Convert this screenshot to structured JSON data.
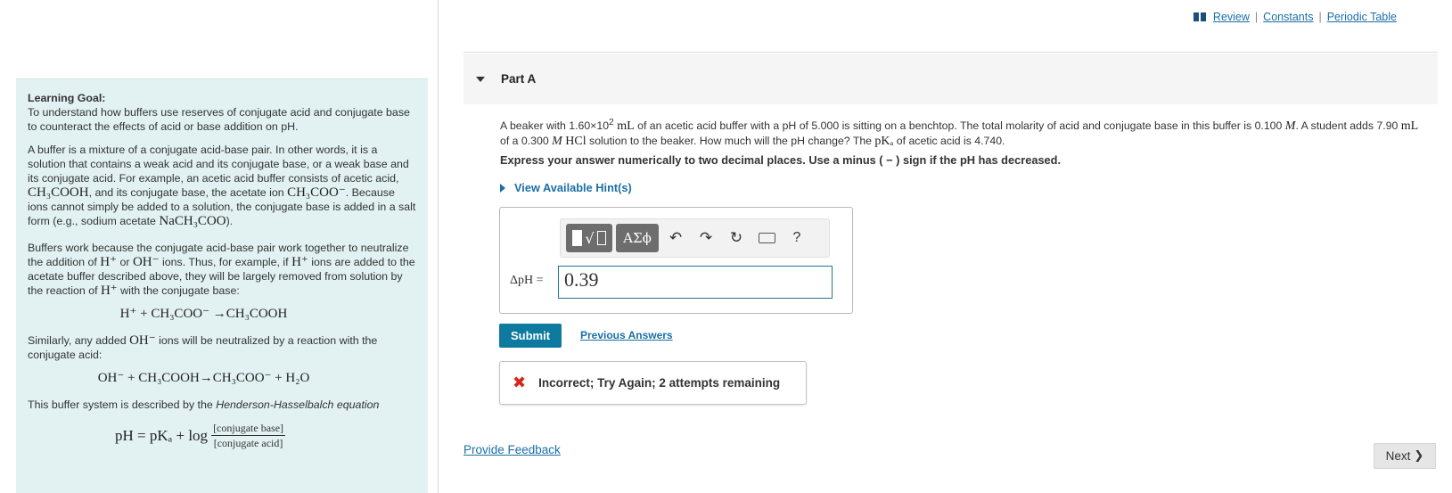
{
  "learning_goal": {
    "title": "Learning Goal:",
    "intro": "To understand how buffers use reserves of conjugate acid and conjugate base to counteract the effects of acid or base addition on pH.",
    "p1_a": "A buffer is a mixture of a conjugate acid-base pair. In other words, it is a solution that contains a weak acid and its conjugate base, or a weak base and its conjugate acid. For example, an acetic acid buffer consists of acetic acid, ",
    "p1_acid": "CH₃COOH",
    "p1_b": ", and its conjugate base, the acetate ion ",
    "p1_ion": "CH₃COO⁻",
    "p1_c": ". Because ions cannot simply be added to a solution, the conjugate base is added in a salt form (e.g., sodium acetate ",
    "p1_salt": "NaCH₃COO",
    "p1_d": ").",
    "p2_a": "Buffers work because the conjugate acid-base pair work together to neutralize the addition of ",
    "p2_h": "H⁺",
    "p2_or": " or ",
    "p2_oh": "OH⁻",
    "p2_b": " ions. Thus, for example, if ",
    "p2_h2": "H⁺",
    "p2_c": " ions are added to the acetate buffer described above, they will be largely removed from solution by the reaction of ",
    "p2_h3": "H⁺",
    "p2_d": " with the conjugate base:",
    "eq1": "H⁺ + CH₃COO⁻ →CH₃COOH",
    "p3_a": "Similarly, any added ",
    "p3_oh": "OH⁻",
    "p3_b": " ions will be neutralized by a reaction with the conjugate acid:",
    "eq2": "OH⁻ + CH₃COOH→CH₃COO⁻ + H₂O",
    "p4_a": "This buffer system is described by the ",
    "p4_em": "Henderson-Hasselbalch equation",
    "hh_lhs": "pH = pKₐ + log",
    "hh_num": "[conjugate base]",
    "hh_den": "[conjugate acid]"
  },
  "top_links": {
    "review": "Review",
    "constants": "Constants",
    "periodic": "Periodic Table",
    "sep": "|"
  },
  "part": {
    "title": "Part A"
  },
  "question": {
    "t1": "A beaker with 1.60×10",
    "t1_sup": "2",
    "t1_unit": " mL",
    "t2": " of an acetic acid buffer with a pH of 5.000 is sitting on a benchtop. The total molarity of acid and conjugate base in this buffer is 0.100 ",
    "t2_m": "M",
    "t3": ". A student adds 7.90 ",
    "t3_unit": "mL",
    "t4": " of a 0.300 ",
    "t4_m": "M",
    "t4_hcl": " HCl",
    "t5": " solution to the beaker. How much will the pH change? The ",
    "t5_pka": "pKₐ",
    "t6": " of acetic acid is 4.740."
  },
  "instruction": "Express your answer numerically to two decimal places. Use a minus ( − ) sign if the pH has decreased.",
  "hints_label": "View Available Hint(s)",
  "toolbar": {
    "greek": "ΑΣϕ",
    "undo": "↶",
    "redo": "↷",
    "reset": "↻",
    "help": "?"
  },
  "answer": {
    "label": "ΔpH =",
    "value": "0.39"
  },
  "submit_label": "Submit",
  "previous_answers": "Previous Answers",
  "feedback": {
    "icon": "✖",
    "text": "Incorrect; Try Again; 2 attempts remaining"
  },
  "provide_feedback": "Provide Feedback",
  "next_label": "Next",
  "next_chevron": "❯"
}
